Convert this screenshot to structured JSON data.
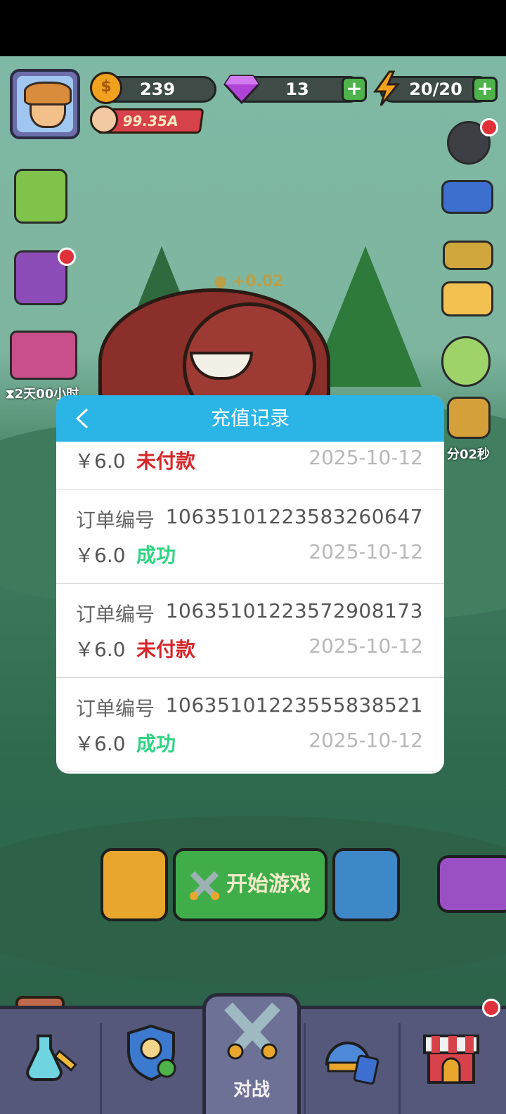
{
  "hud": {
    "coins": "239",
    "gems": "13",
    "energy": "20/20",
    "power": "99.35A",
    "timer_left": "2天00小时",
    "timer_right": "分02秒",
    "float_reward": "+0.02"
  },
  "modal": {
    "title": "充值记录",
    "order_label": "订单编号",
    "records": [
      {
        "order_no": "",
        "amount": "￥6.0",
        "status": "未付款",
        "date": "2025-10-12"
      },
      {
        "order_no": "106351012235832606 47",
        "amount": "￥6.0",
        "status": "成功",
        "date": "2025-10-12"
      },
      {
        "order_no": "106351012235729081 73",
        "amount": "￥6.0",
        "status": "未付款",
        "date": "2025-10-12"
      },
      {
        "order_no": "106351012235558385 21",
        "amount": "￥6.0",
        "status": "成功",
        "date": "2025-10-12"
      }
    ]
  },
  "buttons": {
    "start_game": "开始游戏"
  },
  "nav": {
    "active_label": "对战"
  },
  "colors": {
    "modal_header": "#2bb4e6",
    "status_unpaid": "#d6262a",
    "status_success": "#2fd483"
  }
}
